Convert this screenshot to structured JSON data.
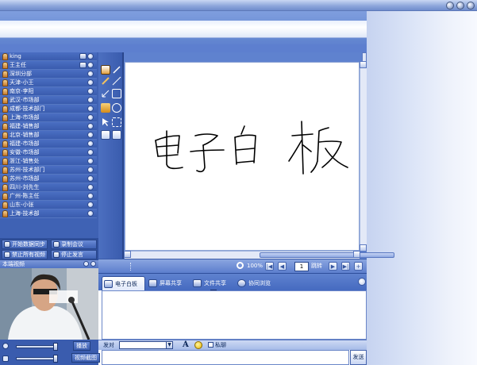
{
  "users": [
    {
      "name": "king"
    },
    {
      "name": "王主任"
    },
    {
      "name": "深圳分部"
    },
    {
      "name": "天津-小王"
    },
    {
      "name": "南京-李阳"
    },
    {
      "name": "武汉-市场部"
    },
    {
      "name": "成都-技术部门"
    },
    {
      "name": "上海-市场部"
    },
    {
      "name": "福建-销售部"
    },
    {
      "name": "北京-销售部"
    },
    {
      "name": "福建-市场部"
    },
    {
      "name": "安徽-市场部"
    },
    {
      "name": "浙江-销售处"
    },
    {
      "name": "苏州-技术部门"
    },
    {
      "name": "苏州-市场部"
    },
    {
      "name": "四川-刘先生"
    },
    {
      "name": "广州-陈主任"
    },
    {
      "name": "山东-小张"
    },
    {
      "name": "上海-技术部"
    }
  ],
  "controls": {
    "data_sync": "开始数据同步",
    "record": "录制会议",
    "mute_all_video": "禁止所有视频",
    "stop_speaking": "停止发言"
  },
  "video": {
    "title": "本端视频",
    "play_label": "播放",
    "record_label": "视频截图"
  },
  "pager": {
    "zoom": "100%",
    "page": "1",
    "jump": "跳转"
  },
  "tabs": [
    {
      "label": "电子白板",
      "active": true
    },
    {
      "label": "屏幕共享",
      "active": false
    },
    {
      "label": "文件共享",
      "active": false
    },
    {
      "label": "协同浏览",
      "active": false
    }
  ],
  "chat": {
    "target_label": "发对",
    "target_value": "",
    "private_label": "私聊",
    "send_label": "发送"
  },
  "whiteboard": {
    "handwriting": "电子白板"
  },
  "colors": {
    "panel_blue": "#3f62b4",
    "row_text": "#ffffff",
    "accent": "#5f82cf"
  }
}
